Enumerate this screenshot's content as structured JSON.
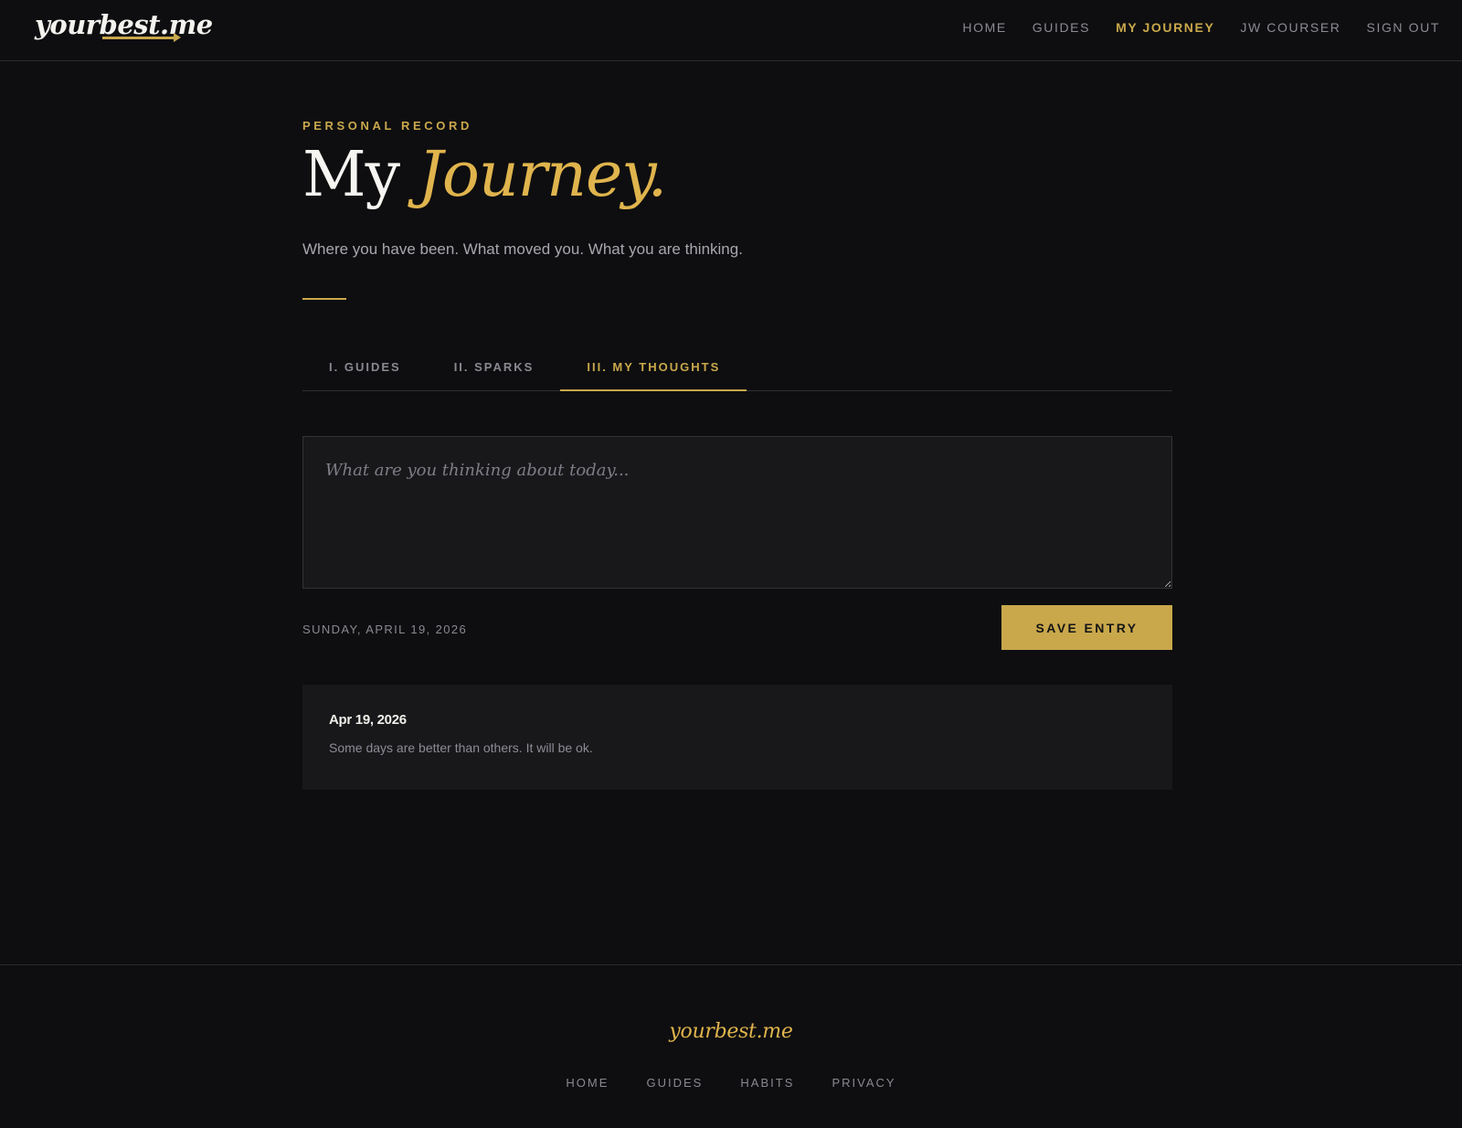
{
  "header": {
    "logo": "yourbest.me",
    "nav": [
      {
        "label": "HOME"
      },
      {
        "label": "GUIDES"
      },
      {
        "label": "MY JOURNEY"
      },
      {
        "label": "JW COURSER"
      },
      {
        "label": "SIGN OUT"
      }
    ],
    "active_nav": "MY JOURNEY"
  },
  "page": {
    "eyebrow": "PERSONAL RECORD",
    "title_main": "My",
    "title_accent": "Journey.",
    "subtitle": "Where you have been. What moved you. What you are thinking."
  },
  "tabs": [
    {
      "label": "I. GUIDES"
    },
    {
      "label": "II. SPARKS"
    },
    {
      "label": "III. MY THOUGHTS"
    }
  ],
  "active_tab": "III. MY THOUGHTS",
  "composer": {
    "placeholder": "What are you thinking about today...",
    "value": "",
    "date": "SUNDAY, APRIL 19, 2026",
    "save_label": "SAVE ENTRY"
  },
  "entries": [
    {
      "date": "Apr 19, 2026",
      "text": "Some days are better than others. It will be ok."
    }
  ],
  "footer": {
    "logo": "yourbest.me",
    "nav": [
      {
        "label": "HOME"
      },
      {
        "label": "GUIDES"
      },
      {
        "label": "HABITS"
      },
      {
        "label": "PRIVACY"
      }
    ]
  },
  "colors": {
    "background": "#0e0e10",
    "accent": "#c9a84c",
    "panel": "#18181b"
  }
}
